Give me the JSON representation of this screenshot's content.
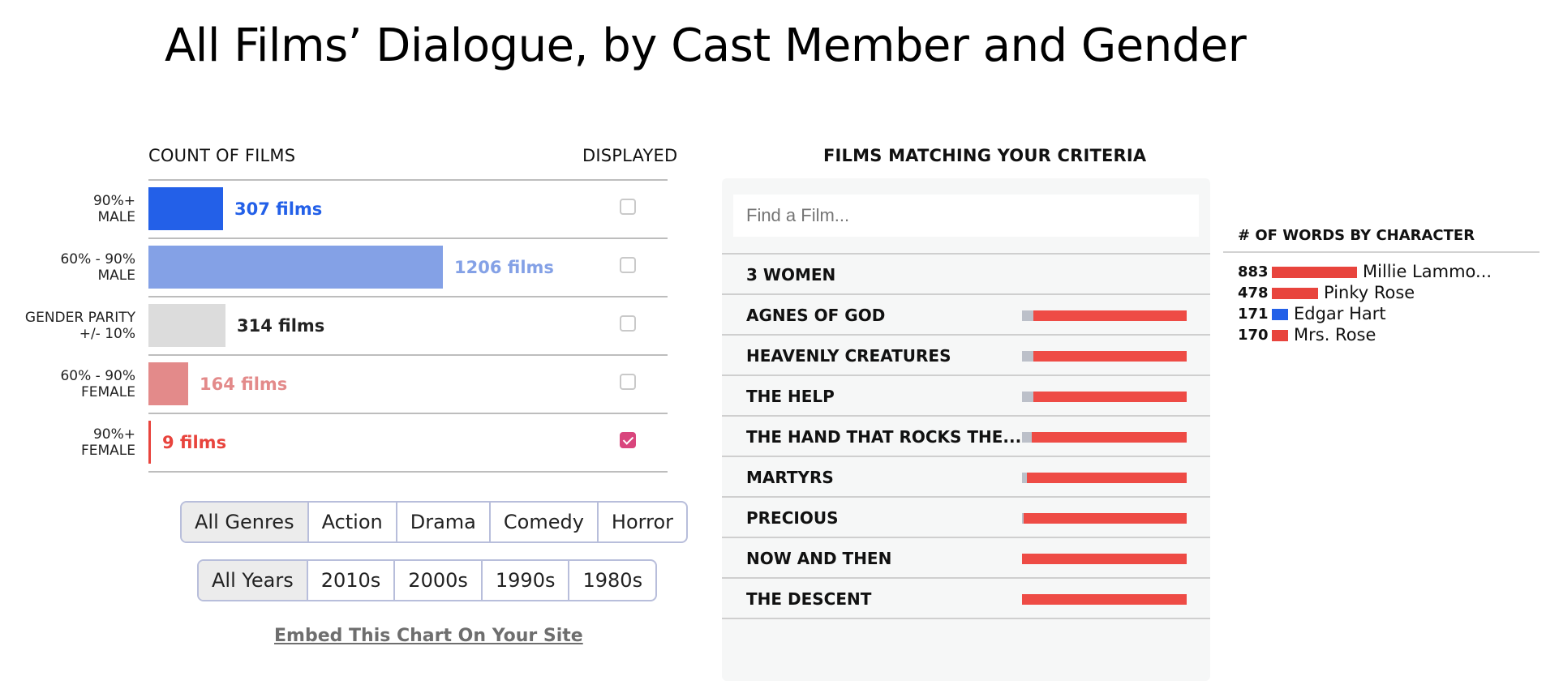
{
  "title": "All Films’ Dialogue, by Cast Member and Gender",
  "left_panel": {
    "count_header": "COUNT OF FILMS",
    "displayed_header": "DISPLAYED",
    "rows": [
      {
        "label_line1": "90%+",
        "label_line2": "MALE",
        "count_text": "307 films",
        "count": 307,
        "color": "#2360e8",
        "text_color": "#2360e8",
        "checked": false
      },
      {
        "label_line1": "60% - 90%",
        "label_line2": "MALE",
        "count_text": "1206 films",
        "count": 1206,
        "color": "#84a1e6",
        "text_color": "#84a1e6",
        "checked": false
      },
      {
        "label_line1": "GENDER PARITY",
        "label_line2": "+/- 10%",
        "count_text": "314 films",
        "count": 314,
        "color": "#dcdcdc",
        "text_color": "#222222",
        "checked": false
      },
      {
        "label_line1": "60% - 90%",
        "label_line2": "FEMALE",
        "count_text": "164 films",
        "count": 164,
        "color": "#e38a8a",
        "text_color": "#e38a8a",
        "checked": false
      },
      {
        "label_line1": "90%+",
        "label_line2": "FEMALE",
        "count_text": "9 films",
        "count": 9,
        "color": "#e8443d",
        "text_color": "#e8443d",
        "checked": true
      }
    ],
    "genre_buttons": [
      "All Genres",
      "Action",
      "Drama",
      "Comedy",
      "Horror"
    ],
    "year_buttons": [
      "All Years",
      "2010s",
      "2000s",
      "1990s",
      "1980s"
    ],
    "embed_link": "Embed This Chart On Your Site"
  },
  "films_panel": {
    "header": "FILMS MATCHING YOUR CRITERIA",
    "search_placeholder": "Find a Film...",
    "films": [
      {
        "name": "3 WOMEN",
        "male_share": null
      },
      {
        "name": "AGNES OF GOD",
        "male_share": 0.07
      },
      {
        "name": "HEAVENLY CREATURES",
        "male_share": 0.07
      },
      {
        "name": "THE HELP",
        "male_share": 0.07
      },
      {
        "name": "THE HAND THAT ROCKS THE...",
        "male_share": 0.06
      },
      {
        "name": "MARTYRS",
        "male_share": 0.03
      },
      {
        "name": "PRECIOUS",
        "male_share": 0.01
      },
      {
        "name": "NOW AND THEN",
        "male_share": 0.0
      },
      {
        "name": "THE DESCENT",
        "male_share": 0.0
      }
    ]
  },
  "words_panel": {
    "header": "# OF WORDS BY CHARACTER",
    "characters": [
      {
        "count": "883",
        "words": 883,
        "name": "Millie Lammo...",
        "color": "#e8443d"
      },
      {
        "count": "478",
        "words": 478,
        "name": "Pinky Rose",
        "color": "#e8443d"
      },
      {
        "count": "171",
        "words": 171,
        "name": "Edgar Hart",
        "color": "#2360e8"
      },
      {
        "count": "170",
        "words": 170,
        "name": "Mrs. Rose",
        "color": "#e8443d"
      }
    ]
  }
}
